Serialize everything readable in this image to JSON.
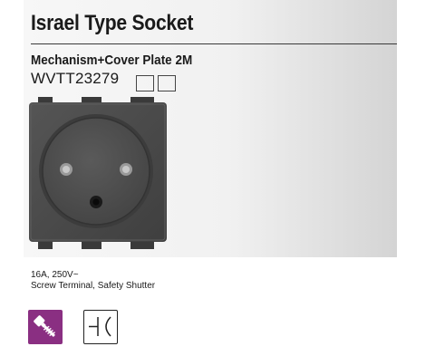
{
  "header": {
    "title": "Israel Type Socket",
    "subtitle": "Mechanism+Cover Plate 2M",
    "product_code": "WVTT23279"
  },
  "specs": {
    "rating": "16A, 250V~",
    "features": "Screw Terminal, Safety Shutter"
  },
  "colors": {
    "panel_gradient_start": "#f7f7f7",
    "panel_gradient_end": "#d4d4d4",
    "socket_body": "#4a4a4a",
    "screw_icon_background": "#8a2f82"
  },
  "icons": {
    "screw_terminal": "screw-icon",
    "switch_symbol": "switch-symbol-icon"
  }
}
